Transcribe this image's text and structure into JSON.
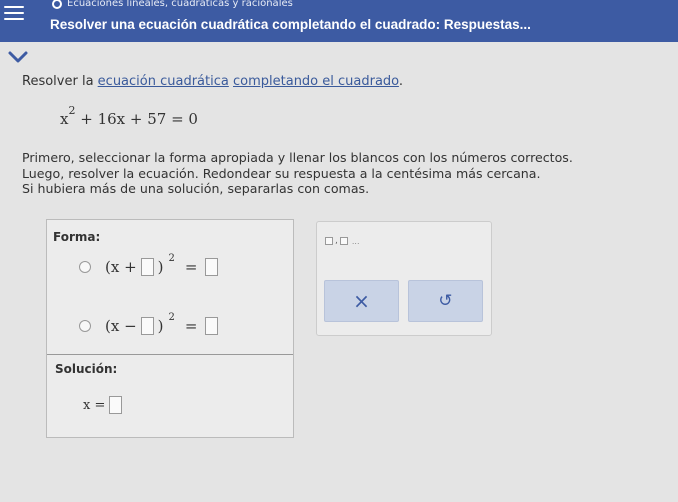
{
  "header": {
    "breadcrumb": "Ecuaciones lineales, cuadráticas y racionales",
    "title": "Resolver una ecuación cuadrática completando el cuadrado: Respuestas..."
  },
  "problem": {
    "intro_prefix": "Resolver la ",
    "intro_link": "ecuación cuadrática",
    "intro_middle": " ",
    "intro_link2": "completando el cuadrado",
    "intro_suffix": ".",
    "equation_var": "x",
    "equation_exp": "2",
    "equation_rest": "+ 16x + 57 = 0",
    "instructions": [
      "Primero, seleccionar la forma apropiada y llenar los blancos con los números correctos.",
      "Luego, resolver la ecuación. Redondear su respuesta a la centésima más cercana.",
      "Si hubiera más de una solución, separarlas con comas."
    ]
  },
  "answer": {
    "form_label": "Forma:",
    "options": [
      {
        "open": "(x +",
        "close": ")",
        "exp": "2",
        "equals": "="
      },
      {
        "open": "(x −",
        "close": ")",
        "exp": "2",
        "equals": "="
      }
    ],
    "solution_label": "Solución:",
    "solution_var": "x =",
    "solution_value": ""
  },
  "tools": {
    "fraction_dots": "...",
    "clear_symbol": "×",
    "undo_symbol": "↺"
  },
  "colors": {
    "header_bg": "#3d5ba3",
    "link": "#3a5a9b",
    "tool_button_bg": "#c9d3e6"
  }
}
